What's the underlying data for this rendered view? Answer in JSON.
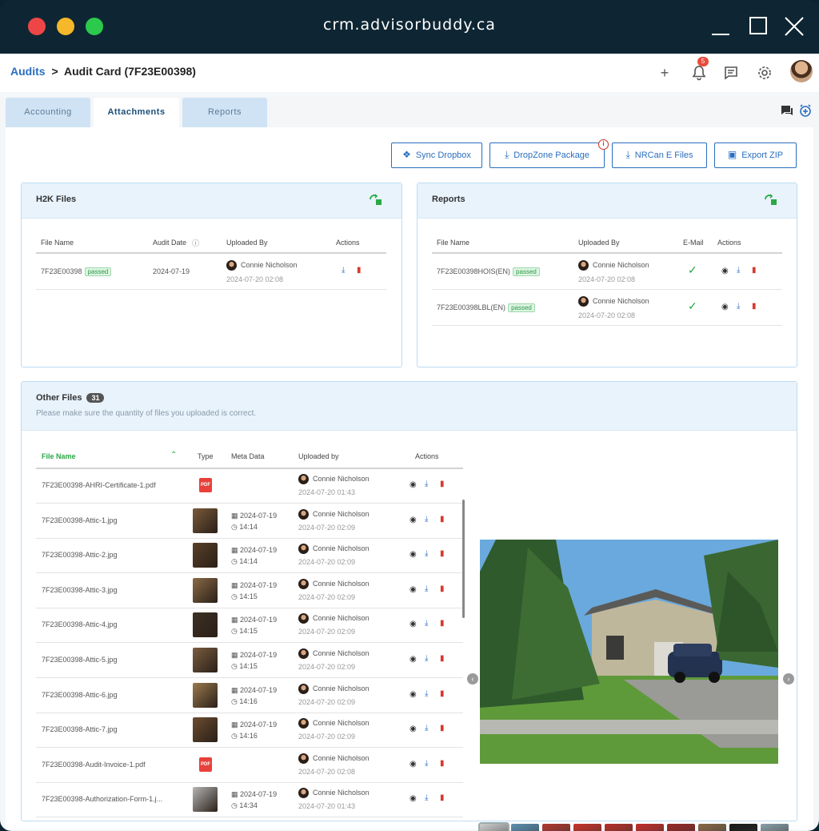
{
  "window": {
    "url": "crm.advisorbuddy.ca"
  },
  "breadcrumb": {
    "root": "Audits",
    "separator": ">",
    "current": "Audit Card (7F23E00398)"
  },
  "header": {
    "notification_count": "5"
  },
  "tabs": [
    {
      "label": "Accounting"
    },
    {
      "label": "Attachments"
    },
    {
      "label": "Reports"
    }
  ],
  "actions": {
    "sync_dropbox": "Sync Dropbox",
    "dropzone": "DropZone Package",
    "nrcan": "NRCan E Files",
    "export_zip": "Export ZIP"
  },
  "h2k": {
    "title": "H2K Files",
    "columns": {
      "file_name": "File Name",
      "audit_date": "Audit Date",
      "uploaded_by": "Uploaded By",
      "actions": "Actions"
    },
    "rows": [
      {
        "file": "7F23E00398",
        "status": "passed",
        "date": "2024-07-19",
        "user": "Connie Nicholson",
        "uploaded": "2024-07-20 02:08"
      }
    ]
  },
  "reports": {
    "title": "Reports",
    "columns": {
      "file_name": "File Name",
      "uploaded_by": "Uploaded By",
      "email": "E-Mail",
      "actions": "Actions"
    },
    "rows": [
      {
        "file": "7F23E00398HOIS(EN)",
        "status": "passed",
        "user": "Connie Nicholson",
        "uploaded": "2024-07-20 02:08"
      },
      {
        "file": "7F23E00398LBL(EN)",
        "status": "passed",
        "user": "Connie Nicholson",
        "uploaded": "2024-07-20 02:08"
      }
    ]
  },
  "other": {
    "title": "Other Files",
    "count": "31",
    "hint": "Please make sure the quantity of files you uploaded is correct.",
    "columns": {
      "file_name": "File Name",
      "type": "Type",
      "meta": "Meta Data",
      "uploaded_by": "Uploaded by",
      "actions": "Actions"
    },
    "pdf_label": "PDF",
    "rows": [
      {
        "file": "7F23E00398-AHRI-Certificate-1.pdf",
        "kind": "pdf",
        "mdate": "",
        "mtime": "",
        "user": "Connie Nicholson",
        "uploaded": "2024-07-20 01:43"
      },
      {
        "file": "7F23E00398-Attic-1.jpg",
        "kind": "img",
        "mdate": "2024-07-19",
        "mtime": "14:14",
        "user": "Connie Nicholson",
        "uploaded": "2024-07-20 02:09"
      },
      {
        "file": "7F23E00398-Attic-2.jpg",
        "kind": "img",
        "mdate": "2024-07-19",
        "mtime": "14:14",
        "user": "Connie Nicholson",
        "uploaded": "2024-07-20 02:09"
      },
      {
        "file": "7F23E00398-Attic-3.jpg",
        "kind": "img",
        "mdate": "2024-07-19",
        "mtime": "14:15",
        "user": "Connie Nicholson",
        "uploaded": "2024-07-20 02:09"
      },
      {
        "file": "7F23E00398-Attic-4.jpg",
        "kind": "img",
        "mdate": "2024-07-19",
        "mtime": "14:15",
        "user": "Connie Nicholson",
        "uploaded": "2024-07-20 02:09"
      },
      {
        "file": "7F23E00398-Attic-5.jpg",
        "kind": "img",
        "mdate": "2024-07-19",
        "mtime": "14:15",
        "user": "Connie Nicholson",
        "uploaded": "2024-07-20 02:09"
      },
      {
        "file": "7F23E00398-Attic-6.jpg",
        "kind": "img",
        "mdate": "2024-07-19",
        "mtime": "14:16",
        "user": "Connie Nicholson",
        "uploaded": "2024-07-20 02:09"
      },
      {
        "file": "7F23E00398-Attic-7.jpg",
        "kind": "img",
        "mdate": "2024-07-19",
        "mtime": "14:16",
        "user": "Connie Nicholson",
        "uploaded": "2024-07-20 02:09"
      },
      {
        "file": "7F23E00398-Audit-Invoice-1.pdf",
        "kind": "pdf",
        "mdate": "",
        "mtime": "",
        "user": "Connie Nicholson",
        "uploaded": "2024-07-20 02:08"
      },
      {
        "file": "7F23E00398-Authorization-Form-1.j...",
        "kind": "img",
        "mdate": "2024-07-19",
        "mtime": "14:34",
        "user": "Connie Nicholson",
        "uploaded": "2024-07-20 01:43"
      }
    ]
  },
  "colors": {
    "accent": "#2b6fbf",
    "success": "#2aa845",
    "danger": "#d63a2e",
    "titlebar": "#0e2633"
  }
}
